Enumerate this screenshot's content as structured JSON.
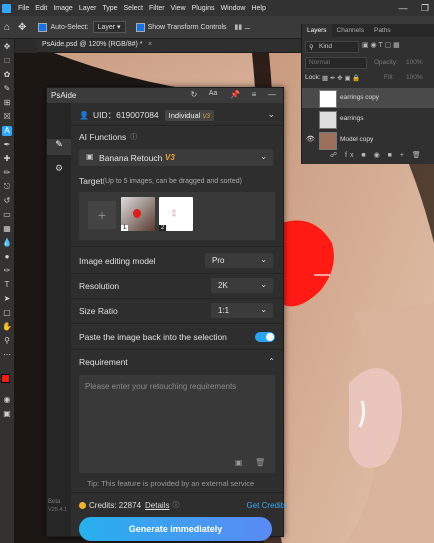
{
  "menubar": {
    "items": [
      "File",
      "Edit",
      "Image",
      "Layer",
      "Type",
      "Select",
      "Filter",
      "View",
      "Plugins",
      "Window",
      "Help"
    ]
  },
  "optionsbar": {
    "auto_select_label": "Auto-Select:",
    "auto_select_value": "Layer",
    "show_transform_label": "Show Transform Controls"
  },
  "document_tab": {
    "title": "PsAide.psd @ 120% (RGB/8#) *"
  },
  "layers_panel": {
    "tabs": [
      "Layers",
      "Channels",
      "Paths"
    ],
    "filter_kind": "Kind",
    "blend_mode": "Normal",
    "opacity_label": "Opacity:",
    "opacity_value": "100%",
    "lock_label": "Lock:",
    "fill_label": "Fill:",
    "fill_value": "100%",
    "layers": [
      {
        "name": "earrings copy",
        "visible": false
      },
      {
        "name": "earrings",
        "visible": false
      },
      {
        "name": "Model copy",
        "visible": true
      }
    ]
  },
  "psaide": {
    "title": "PsAide",
    "uid_label": "UID：619007084",
    "plan_label": "Individual",
    "plan_badge": "V3",
    "ai_functions_label": "AI Functions",
    "function_value": "Banana Retouch",
    "function_badge": "V3",
    "target_label": "Target",
    "target_hint": "(Up to 5 images, can be dragged and sorted)",
    "thumb_1_index": "1",
    "thumb_2_index": "2",
    "model_label": "Image editing model",
    "model_value": "Pro",
    "resolution_label": "Resolution",
    "resolution_value": "2K",
    "ratio_label": "Size Ratio",
    "ratio_value": "1:1",
    "paste_back_label": "Paste the image back into the selection",
    "paste_back_on": true,
    "requirement_label": "Requirement",
    "requirement_placeholder": "Please enter your retouching requirements",
    "tip": "Tip: This feature is provided by an external service",
    "credits_label": "Credits: 22874",
    "details_label": "Details",
    "get_credits_label": "Get Credits",
    "generate_label": "Generate immediately",
    "beta_label": "Beta",
    "version_label": "V25.4.1"
  },
  "colors": {
    "accent": "#31a8ff",
    "gradient_start": "#27b0ee",
    "gradient_end": "#5a8af4",
    "badge": "#e8a33a",
    "selection_red": "#ff1a14"
  }
}
